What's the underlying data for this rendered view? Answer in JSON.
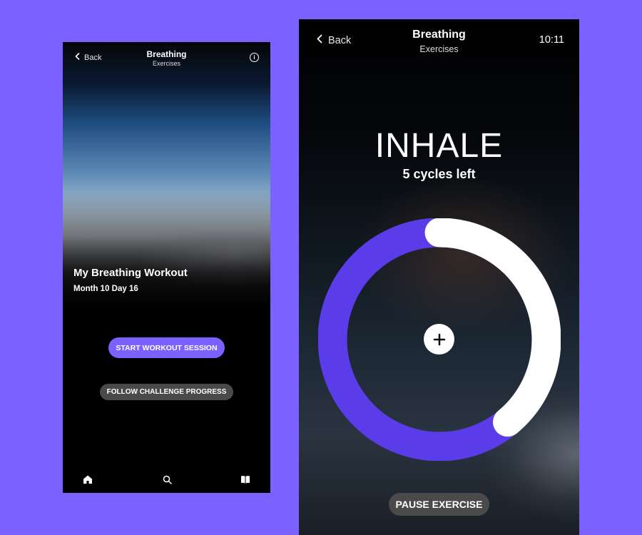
{
  "colors": {
    "background": "#7b61ff",
    "accent": "#7b61ff",
    "ring_track": "#5a3de8",
    "ring_progress": "#ffffff",
    "secondary_button": "#4a4a4a"
  },
  "left_screen": {
    "header": {
      "back_label": "Back",
      "title": "Breathing",
      "subtitle": "Exercises",
      "info_icon": "info-icon"
    },
    "workout": {
      "title": "My Breathing Workout",
      "subtitle": "Month 10 Day 16"
    },
    "buttons": {
      "start": "START WORKOUT SESSION",
      "follow": "FOLLOW CHALLENGE PROGRESS"
    },
    "tabbar": {
      "items": [
        {
          "icon": "home-icon"
        },
        {
          "icon": "search-icon"
        },
        {
          "icon": "book-icon"
        }
      ]
    }
  },
  "right_screen": {
    "header": {
      "back_label": "Back",
      "title": "Breathing",
      "subtitle": "Exercises",
      "time": "10:11"
    },
    "phase": "INHALE",
    "cycles_left": "5 cycles left",
    "progress": 0.39,
    "center_icon": "plus-icon",
    "pause_label": "PAUSE EXERCISE"
  }
}
